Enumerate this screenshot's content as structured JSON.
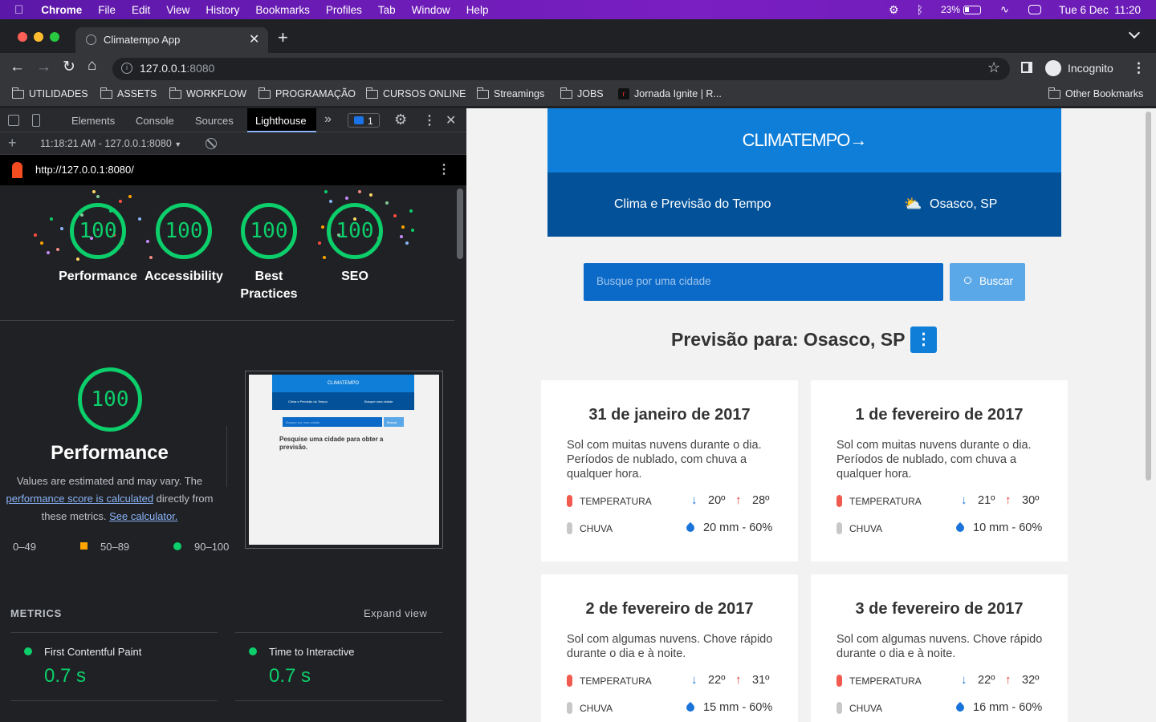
{
  "menubar": {
    "app": "Chrome",
    "items": [
      "File",
      "Edit",
      "View",
      "History",
      "Bookmarks",
      "Profiles",
      "Tab",
      "Window",
      "Help"
    ],
    "battery": "23%",
    "datetime": "Tue 6 Dec  11:20"
  },
  "tab": {
    "title": "Climatempo App"
  },
  "omnibox": {
    "host": "127.0.0.1",
    "port": ":8080",
    "profile": "Incognito"
  },
  "bookmarks": [
    "UTILIDADES",
    "ASSETS",
    "WORKFLOW",
    "PROGRAMAÇÃO",
    "CURSOS ONLINE",
    "Streamings",
    "JOBS",
    "Jornada Ignite | R...",
    "Other Bookmarks"
  ],
  "devtools": {
    "tabs": [
      "Elements",
      "Console",
      "Sources",
      "Lighthouse"
    ],
    "issues_count": "1",
    "report_time": "11:18:21 AM - 127.0.0.1:8080",
    "report_url": "http://127.0.0.1:8080/",
    "gauges": [
      {
        "score": "100",
        "label": "Performance"
      },
      {
        "score": "100",
        "label": "Accessibility"
      },
      {
        "score": "100",
        "label": "Best Practices"
      },
      {
        "score": "100",
        "label": "SEO"
      }
    ],
    "main_score": "100",
    "main_title": "Performance",
    "desc_1": "Values are estimated and may vary. The",
    "desc_link": "performance score is calculated",
    "desc_2": " directly from",
    "desc_3": "these metrics.",
    "desc_link2": "See calculator.",
    "legend": [
      "0–49",
      "50–89",
      "90–100"
    ],
    "thumb": {
      "logo": "CLIMATEMPO",
      "nav1": "Clima e Previsão do Tempo",
      "nav2": "Busque uma cidade",
      "search": "Busque por uma cidade",
      "btn": "Buscar",
      "msg": "Pesquise uma cidade para obter a previsão."
    },
    "metrics_title": "METRICS",
    "expand": "Expand view",
    "metrics": [
      {
        "name": "First Contentful Paint",
        "value": "0.7 s"
      },
      {
        "name": "Time to Interactive",
        "value": "0.7 s"
      }
    ],
    "colors": {
      "pass": "#0cce6b",
      "average": "#ffa400",
      "fail": "#ff4e42"
    }
  },
  "page": {
    "logo": "CLIMATEMPO",
    "nav_title": "Clima e Previsão do Tempo",
    "nav_city": "Osasco, SP",
    "search_placeholder": "Busque por uma cidade",
    "search_button": "Buscar",
    "forecast_title": "Previsão para: Osasco, SP",
    "labels": {
      "temp": "TEMPERATURA",
      "rain": "CHUVA"
    },
    "cards": [
      {
        "date": "31 de janeiro de 2017",
        "desc": "Sol com muitas nuvens durante o dia. Períodos de nublado, com chuva a qualquer hora.",
        "min": "20º",
        "max": "28º",
        "rain": "20 mm - 60%"
      },
      {
        "date": "1 de fevereiro de 2017",
        "desc": "Sol com muitas nuvens durante o dia. Períodos de nublado, com chuva a qualquer hora.",
        "min": "21º",
        "max": "30º",
        "rain": "10 mm - 60%"
      },
      {
        "date": "2 de fevereiro de 2017",
        "desc": "Sol com algumas nuvens. Chove rápido durante o dia e à noite.",
        "min": "22º",
        "max": "31º",
        "rain": "15 mm - 60%"
      },
      {
        "date": "3 de fevereiro de 2017",
        "desc": "Sol com algumas nuvens. Chove rápido durante o dia e à noite.",
        "min": "22º",
        "max": "32º",
        "rain": "16 mm - 60%"
      }
    ],
    "colors": {
      "header": "#0e7ed8",
      "nav": "#035299",
      "search": "#0b69c7",
      "button": "#5ba8e8",
      "temp_pill": "#f05a4f",
      "rain_pill": "#c8c8c8",
      "arrow_down": "#1a73d9",
      "arrow_up": "#e53935",
      "drop": "#1a73d9"
    }
  }
}
